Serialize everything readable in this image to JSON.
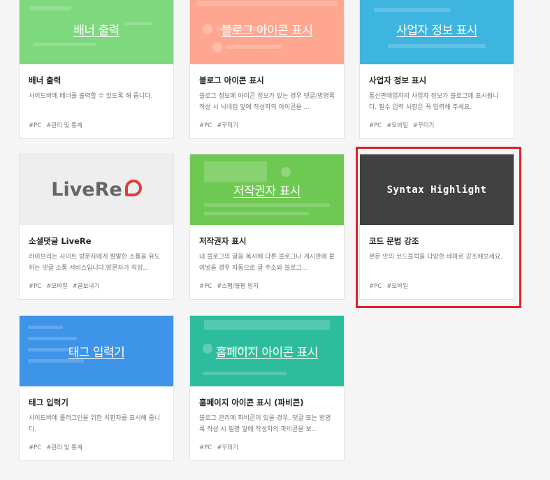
{
  "cards": [
    {
      "thumb_label": "배너 출력",
      "title": "배너 출력",
      "description": "사이드바에 배너를 출력할 수 있도록 해 줍니다.",
      "tags": [
        "#PC",
        "#관리 및 통계"
      ],
      "color": "#7ed87e"
    },
    {
      "thumb_label": "블로그 아이콘 표시",
      "title": "블로그 아이콘 표시",
      "description": "블로그 정보에 아이콘 정보가 있는 경우 댓글/방명록 작성 시 닉네임 앞에 작성자의 아이콘을 ...",
      "tags": [
        "#PC",
        "#꾸미기"
      ],
      "color": "#ffa690"
    },
    {
      "thumb_label": "사업자 정보 표시",
      "title": "사업자 정보 표시",
      "description": "통신판매업자의 사업자 정보가 블로그에 표시됩니다. 필수 입력 사항은 꼭 입력해 주세요.",
      "tags": [
        "#PC",
        "#모바일",
        "#꾸미기"
      ],
      "color": "#3db5e0"
    },
    {
      "thumb_logo": "LiveRe",
      "title": "소셜댓글 LiveRe",
      "description": "라이브리는 사이트 방문자에게 활발한 소통을 유도하는 댓글 소통 서비스입니다.방문자가 작성...",
      "tags": [
        "#PC",
        "#모바일",
        "#글보내기"
      ],
      "color": "#eeeeee"
    },
    {
      "thumb_label": "저작권자 표시",
      "title": "저작권자 표시",
      "description": "내 블로그의 글을 복사해 다른 블로그나 게시판에 붙여넣을 경우 자동으로 글 주소와 블로그...",
      "tags": [
        "#PC",
        "#스팸/불펌 방지"
      ],
      "color": "#6ec952"
    },
    {
      "thumb_label": "Syntax Highlight",
      "title": "코드 문법 강조",
      "description": "본문 안의 코드블럭을 다양한 테마로 강조해보세요.",
      "tags": [
        "#PC",
        "#모바일"
      ],
      "color": "#414141"
    },
    {
      "thumb_label": "태그 입력기",
      "title": "태그 입력기",
      "description": "사이드바에 플러그인을 위한 치환자를 표시해 줍니다.",
      "tags": [
        "#PC",
        "#관리 및 통계"
      ],
      "color": "#3d94e8"
    },
    {
      "thumb_label": "홈페이지 아이콘 표시",
      "title": "홈페이지 아이콘 표시 (파비콘)",
      "description": "블로그 관리에 파비콘이 있을 경우, 댓글 또는 방명록 작성 시 필명 앞에 작성자의 파비콘을 보...",
      "tags": [
        "#PC",
        "#꾸미기"
      ],
      "color": "#2ebd9c"
    }
  ],
  "selection_color": "#e0202c"
}
